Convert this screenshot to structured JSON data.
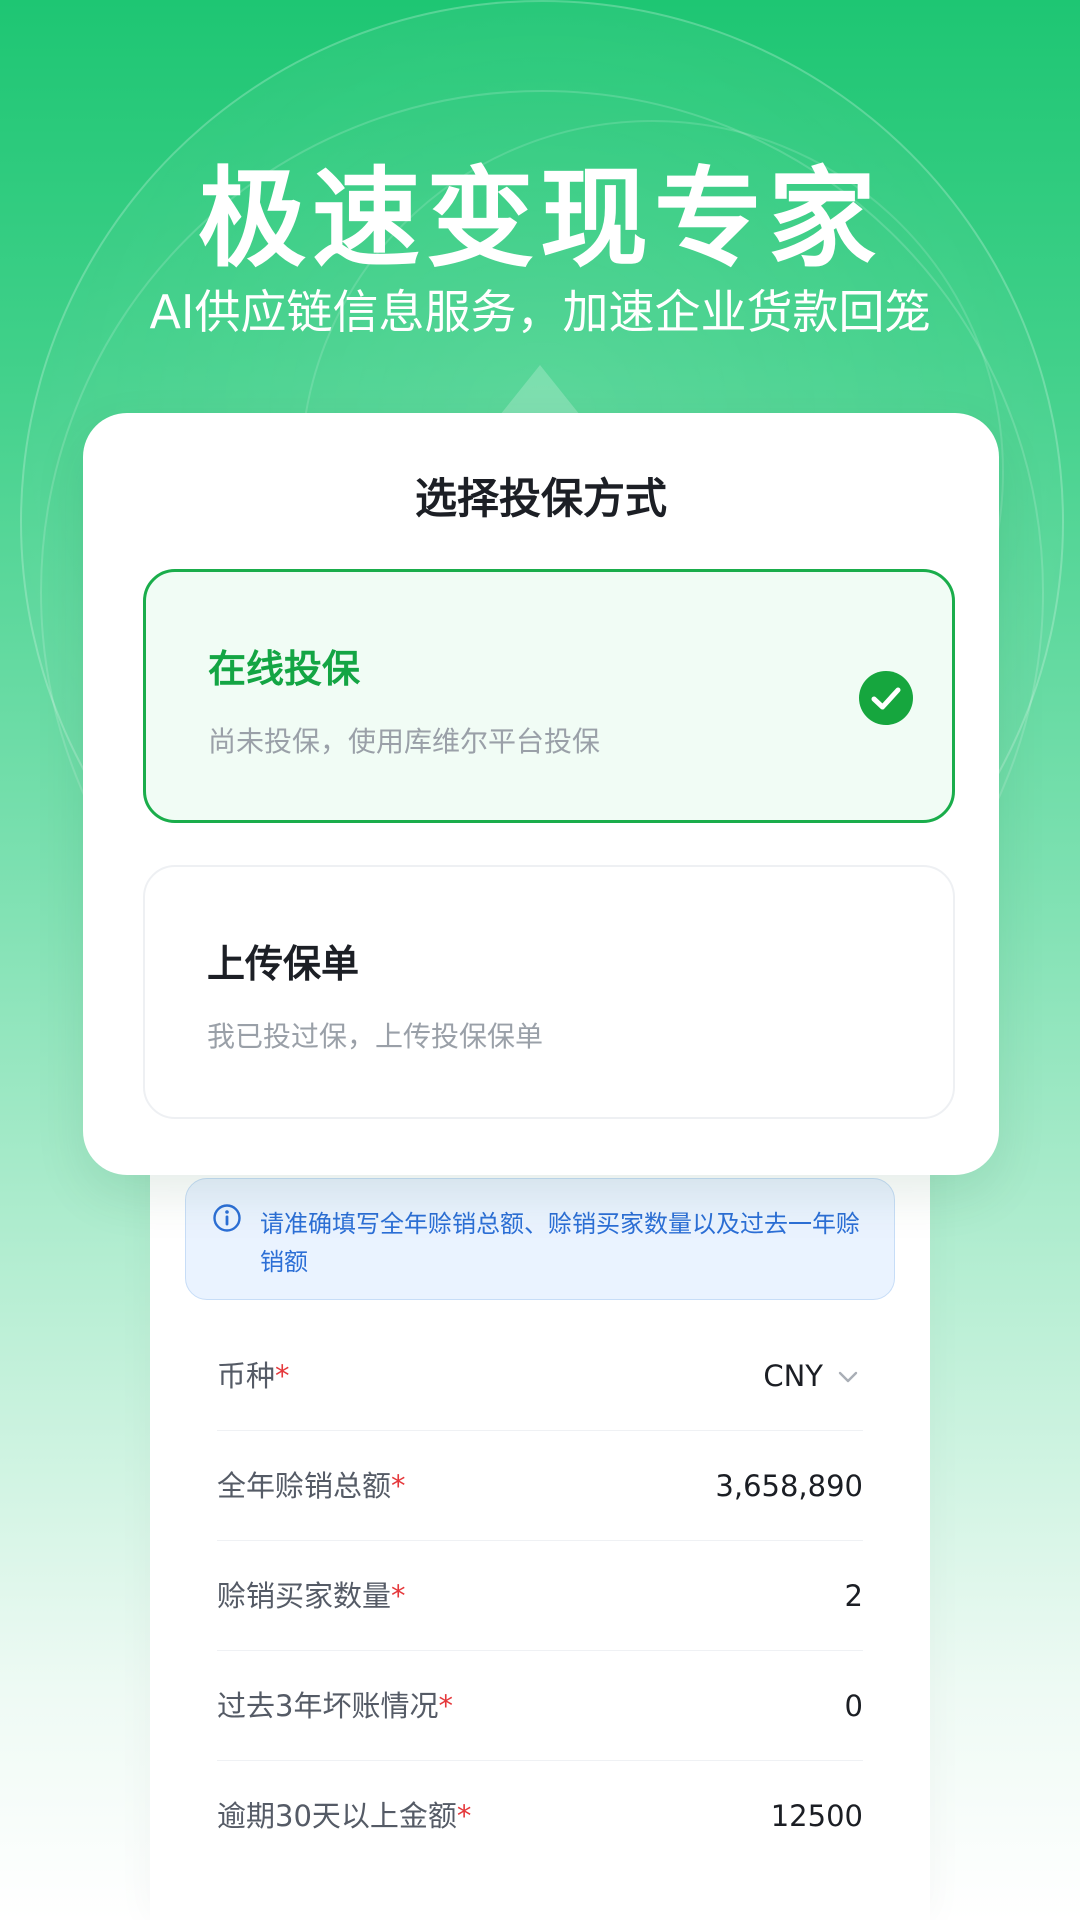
{
  "hero": {
    "title": "极速变现专家",
    "subtitle": "AI供应链信息服务，加速企业货款回笼"
  },
  "modal": {
    "title": "选择投保方式",
    "options": [
      {
        "title": "在线投保",
        "description": "尚未投保，使用库维尔平台投保",
        "selected": true,
        "icon": "check-circle-icon"
      },
      {
        "title": "上传保单",
        "description": "我已投过保，上传投保保单",
        "selected": false
      }
    ]
  },
  "notice": {
    "icon": "info-icon",
    "text": "请准确填写全年赊销总额、赊销买家数量以及过去一年赊销额"
  },
  "form": {
    "required_mark": "*",
    "rows": [
      {
        "label": "币种",
        "value": "CNY",
        "control": "select"
      },
      {
        "label": "全年赊销总额",
        "value": "3,658,890"
      },
      {
        "label": "赊销买家数量",
        "value": "2"
      },
      {
        "label": "过去3年坏账情况",
        "value": "0"
      },
      {
        "label": "逾期30天以上金额",
        "value": "12500"
      }
    ]
  },
  "colors": {
    "brand_green": "#14a544",
    "check_green": "#16a63e",
    "notice_blue": "#2c6fd6",
    "required_red": "#e5383b"
  }
}
